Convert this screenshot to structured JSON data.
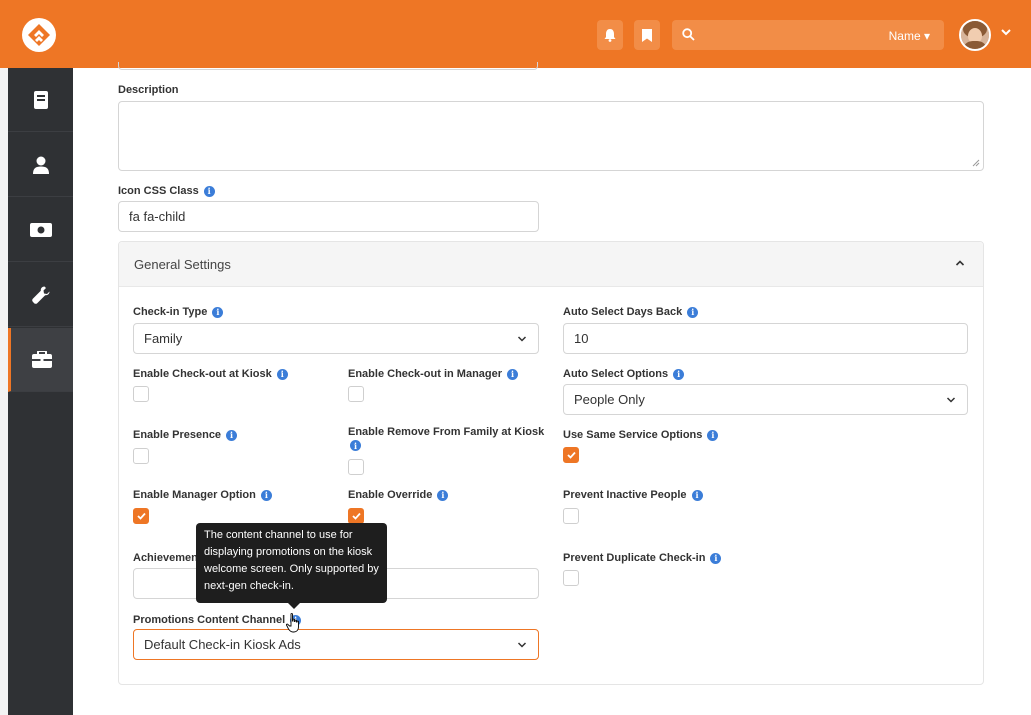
{
  "header": {
    "search_scope": "Name",
    "icons": [
      "bell-icon",
      "bookmark-icon",
      "search-icon",
      "chevron-down-icon"
    ]
  },
  "sidebar": {
    "items": [
      {
        "icon": "book-icon"
      },
      {
        "icon": "person-icon"
      },
      {
        "icon": "money-icon"
      },
      {
        "icon": "wrench-icon"
      },
      {
        "icon": "briefcase-icon",
        "active": true
      }
    ]
  },
  "form": {
    "description_label": "Description",
    "description_value": "",
    "icon_css_label": "Icon CSS Class",
    "icon_css_value": "fa fa-child",
    "panel_title": "General Settings",
    "checkin_type_label": "Check-in Type",
    "checkin_type_value": "Family",
    "auto_select_days_label": "Auto Select Days Back",
    "auto_select_days_value": "10",
    "enable_checkout_kiosk_label": "Enable Check-out at Kiosk",
    "enable_checkout_kiosk": false,
    "enable_checkout_manager_label": "Enable Check-out in Manager",
    "enable_checkout_manager": false,
    "auto_select_options_label": "Auto Select Options",
    "auto_select_options_value": "People Only",
    "enable_presence_label": "Enable Presence",
    "enable_presence": false,
    "enable_remove_family_label": "Enable Remove From Family at Kiosk",
    "enable_remove_family": false,
    "use_same_service_label": "Use Same Service Options",
    "use_same_service": true,
    "enable_manager_option_label": "Enable Manager Option",
    "enable_manager_option": true,
    "enable_override_label": "Enable Override",
    "enable_override": true,
    "prevent_inactive_label": "Prevent Inactive People",
    "prevent_inactive": false,
    "achievement_label_partial": "Achievemen",
    "achievement_value": "",
    "prevent_duplicate_label": "Prevent Duplicate Check-in",
    "prevent_duplicate": false,
    "promotions_label": "Promotions Content Channel",
    "promotions_value": "Default Check-in Kiosk Ads"
  },
  "tooltip": {
    "text": "The content channel to use for displaying promotions on the kiosk welcome screen. Only supported by next-gen check-in."
  },
  "colors": {
    "brand": "#ee7625",
    "sidebar": "#2f3134",
    "info": "#3b7dd8"
  }
}
